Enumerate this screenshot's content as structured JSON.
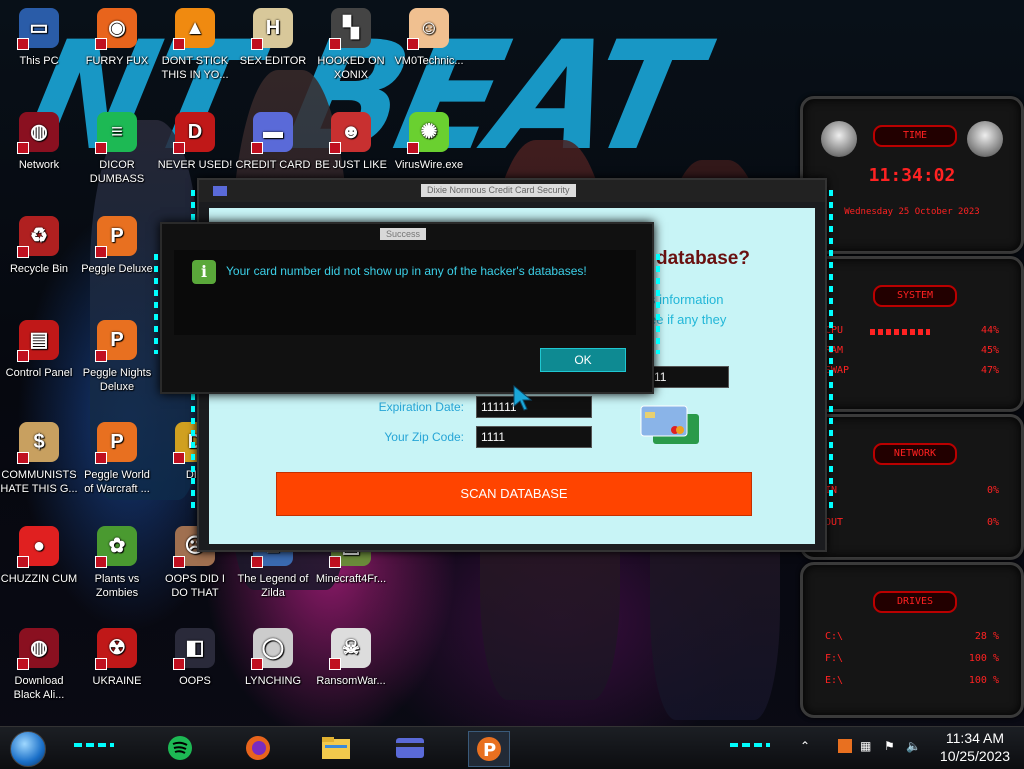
{
  "desktop_icons": [
    {
      "label": "This PC",
      "icon": "monitor-icon",
      "color": "#2a5ca8"
    },
    {
      "label": "FURRY FUX",
      "icon": "firefox-icon",
      "color": "#e8641c"
    },
    {
      "label": "DONT STICK THIS IN YO...",
      "icon": "vlc-cone-icon",
      "color": "#f08a10"
    },
    {
      "label": "SEX EDITOR",
      "icon": "hxd-editor-icon",
      "color": "#d8c89a"
    },
    {
      "label": "HOOKED ON XONIX",
      "icon": "xonix-game-icon",
      "color": "#444444"
    },
    {
      "label": "VM0Technic...",
      "icon": "doctor-avatar-icon",
      "color": "#f0c090"
    },
    {
      "label": "Network",
      "icon": "network-globe-icon",
      "color": "#8a1020"
    },
    {
      "label": "DICOR DUMBASS",
      "icon": "discord-icon",
      "color": "#1db954"
    },
    {
      "label": "NEVER USED!",
      "icon": "devcpp-icon",
      "color": "#c01818"
    },
    {
      "label": "CREDIT CARD",
      "icon": "credit-card-icon",
      "color": "#5a6ad8"
    },
    {
      "label": "BE JUST LIKE",
      "icon": "santa-face-icon",
      "color": "#c83030"
    },
    {
      "label": "VirusWire.exe",
      "icon": "lime-icon",
      "color": "#6ad030"
    },
    {
      "label": "Recycle Bin",
      "icon": "recycle-bin-icon",
      "color": "#b02020"
    },
    {
      "label": "Peggle Deluxe",
      "icon": "peggle-icon",
      "color": "#e87020"
    },
    {
      "label": "Control Panel",
      "icon": "control-panel-icon",
      "color": "#c01818"
    },
    {
      "label": "Peggle Nights Deluxe",
      "icon": "peggle-nights-icon",
      "color": "#e87020"
    },
    {
      "label": "COMMUNISTS HATE THIS G...",
      "icon": "money-bag-icon",
      "color": "#c8a060"
    },
    {
      "label": "Peggle World of Warcraft ...",
      "icon": "peggle-wow-icon",
      "color": "#e87020"
    },
    {
      "label": "DIE",
      "icon": "die-icon",
      "color": "#d0a020"
    },
    {
      "label": "CHUZZIN CUM",
      "icon": "chuzzle-icon",
      "color": "#e02020"
    },
    {
      "label": "Plants vs Zombies",
      "icon": "pvz-icon",
      "color": "#4a9a30"
    },
    {
      "label": "OOPS DID I DO THAT",
      "icon": "face-photo-icon",
      "color": "#a07050"
    },
    {
      "label": "The Legend of Zilda",
      "icon": "zelda-icon",
      "color": "#3a6ab0"
    },
    {
      "label": "Minecraft4Fr...",
      "icon": "minecraft-icon",
      "color": "#6a8a3a"
    },
    {
      "label": "Download Black Ali...",
      "icon": "alienware-orb-icon",
      "color": "#8a1020"
    },
    {
      "label": "UKRAINE",
      "icon": "radiation-icon",
      "color": "#c01818"
    },
    {
      "label": "OOPS",
      "icon": "system-tool-icon",
      "color": "#2a2a3a"
    },
    {
      "label": "LYNCHING",
      "icon": "noose-icon",
      "color": "#cccccc"
    },
    {
      "label": "RansomWar...",
      "icon": "skull-icon",
      "color": "#dddddd"
    }
  ],
  "gadgets": {
    "time": {
      "title": "TIME",
      "clock": "11:34:02",
      "date": "Wednesday 25 October 2023"
    },
    "system": {
      "title": "SYSTEM",
      "rows": [
        {
          "label": "CPU",
          "value": "44%"
        },
        {
          "label": "RAM",
          "value": "45%"
        },
        {
          "label": "SWAP",
          "value": "47%"
        }
      ]
    },
    "network": {
      "title": "NETWORK",
      "rows": [
        {
          "label": "IN",
          "value": "0%"
        },
        {
          "label": "OUT",
          "value": "0%"
        }
      ]
    },
    "drives": {
      "title": "DRIVES",
      "rows": [
        {
          "label": "C:\\",
          "value": "28 %"
        },
        {
          "label": "F:\\",
          "value": "100 %"
        },
        {
          "label": "E:\\",
          "value": "100 %"
        }
      ]
    }
  },
  "app_window": {
    "title": "Dixie Normous Credit Card Security",
    "heading": "database?",
    "info_line1": "s information",
    "info_line2": "ee if any they",
    "card_number_value": "11",
    "expiration_label": "Expiration Date:",
    "expiration_value": "111111",
    "zip_label": "Your Zip Code:",
    "zip_value": "1111",
    "scan_button": "SCAN DATABASE"
  },
  "dialog": {
    "title": "Success",
    "message": "Your card number did not show up in any of the hacker's databases!",
    "ok_button": "OK"
  },
  "taskbar": {
    "pinned": [
      "spotify-icon",
      "firefox-icon",
      "file-explorer-icon",
      "credit-card-app-icon",
      "peggle-app-icon"
    ],
    "active_index": 4,
    "clock_time": "11:34 AM",
    "clock_date": "10/25/2023"
  },
  "colors": {
    "accent_cyan": "#1fc8d2",
    "gadget_red": "#ff2222",
    "scan_orange": "#ff4400",
    "window_bg": "#c8f4f6"
  }
}
